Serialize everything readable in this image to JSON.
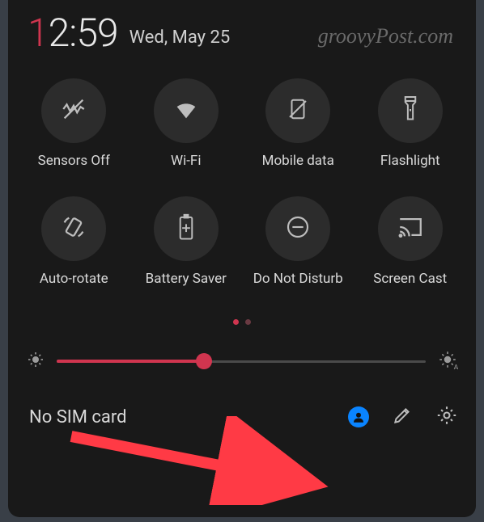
{
  "status": {
    "time_hour_first": "1",
    "time_rest": "2:59",
    "date": "Wed, May 25"
  },
  "watermark": "groovyPost.com",
  "tiles": [
    {
      "label": "Sensors Off"
    },
    {
      "label": "Wi-Fi"
    },
    {
      "label": "Mobile data"
    },
    {
      "label": "Flashlight"
    },
    {
      "label": "Auto-rotate"
    },
    {
      "label": "Battery Saver"
    },
    {
      "label": "Do Not Disturb"
    },
    {
      "label": "Screen Cast"
    }
  ],
  "pager": {
    "current": 1,
    "total": 2
  },
  "brightness": {
    "percent": 40
  },
  "bottom": {
    "sim_status": "No SIM card"
  },
  "colors": {
    "accent": "#d0354f",
    "user_button": "#0a84ff",
    "arrow": "#ff3a45"
  }
}
